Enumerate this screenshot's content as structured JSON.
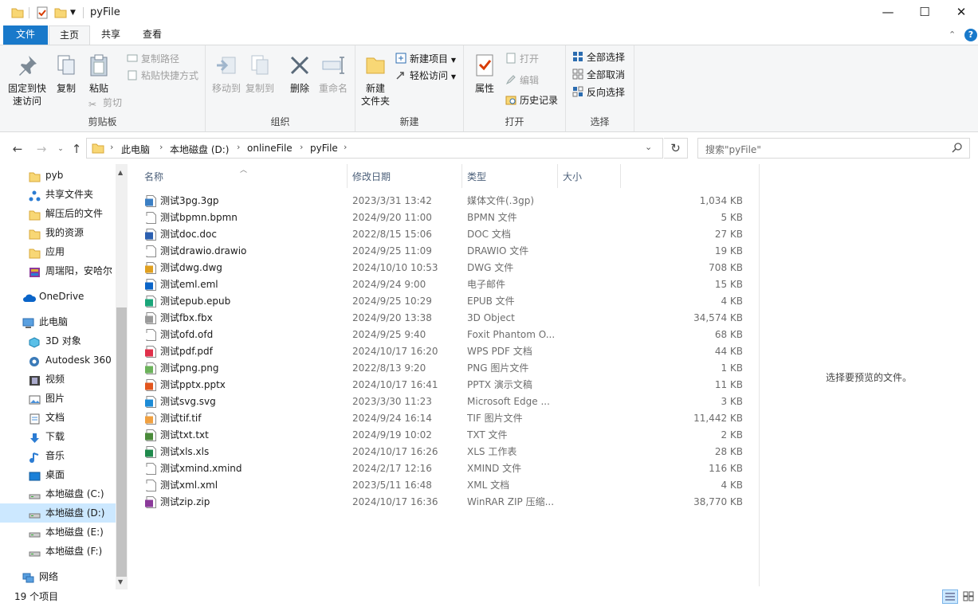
{
  "window": {
    "title": "pyFile",
    "minimize": "—",
    "maximize": "☐",
    "close": "✕"
  },
  "ribbon_tabs": [
    "文件",
    "主页",
    "共享",
    "查看"
  ],
  "ribbon": {
    "clipboard": {
      "pin": [
        "固定到快",
        "速访问"
      ],
      "copy": "复制",
      "paste": "粘贴",
      "copy_path": "复制路径",
      "paste_shortcut": "粘贴快捷方式",
      "cut": "剪切",
      "label": "剪贴板"
    },
    "organize": {
      "move_to": "移动到",
      "copy_to": "复制到",
      "delete": "删除",
      "rename": "重命名",
      "label": "组织"
    },
    "new": {
      "new_folder": [
        "新建",
        "文件夹"
      ],
      "new_item": "新建项目",
      "easy_access": "轻松访问",
      "label": "新建"
    },
    "open": {
      "properties": "属性",
      "open": "打开",
      "edit": "编辑",
      "history": "历史记录",
      "label": "打开"
    },
    "select": {
      "select_all": "全部选择",
      "select_none": "全部取消",
      "invert": "反向选择",
      "label": "选择"
    }
  },
  "address": {
    "crumbs": [
      "此电脑",
      "本地磁盘 (D:)",
      "onlineFile",
      "pyFile"
    ]
  },
  "search": {
    "placeholder": "搜索\"pyFile\""
  },
  "nav": [
    {
      "label": "pyb",
      "icon": "folder-icon"
    },
    {
      "label": "共享文件夹",
      "icon": "share-icon"
    },
    {
      "label": "解压后的文件",
      "icon": "folder-icon"
    },
    {
      "label": "我的资源",
      "icon": "folder-icon"
    },
    {
      "label": "应用",
      "icon": "folder-icon"
    },
    {
      "label": "周瑞阳，安哈尔",
      "icon": "archive-icon"
    },
    {
      "label": "OneDrive",
      "icon": "cloud-icon"
    },
    {
      "label": "此电脑",
      "icon": "pc-icon"
    },
    {
      "label": "3D 对象",
      "icon": "cube-icon"
    },
    {
      "label": "Autodesk 360",
      "icon": "autodesk-icon"
    },
    {
      "label": "视频",
      "icon": "video-icon"
    },
    {
      "label": "图片",
      "icon": "picture-icon"
    },
    {
      "label": "文档",
      "icon": "document-icon"
    },
    {
      "label": "下载",
      "icon": "download-icon"
    },
    {
      "label": "音乐",
      "icon": "music-icon"
    },
    {
      "label": "桌面",
      "icon": "desktop-icon"
    },
    {
      "label": "本地磁盘 (C:)",
      "icon": "drive-icon"
    },
    {
      "label": "本地磁盘 (D:)",
      "icon": "drive-icon",
      "selected": true
    },
    {
      "label": "本地磁盘 (E:)",
      "icon": "drive-icon"
    },
    {
      "label": "本地磁盘 (F:)",
      "icon": "drive-icon"
    },
    {
      "label": "网络",
      "icon": "network-icon"
    }
  ],
  "columns": {
    "name": "名称",
    "date": "修改日期",
    "type": "类型",
    "size": "大小"
  },
  "files": [
    {
      "name": "测试3pg.3gp",
      "date": "2023/3/31 13:42",
      "type": "媒体文件(.3gp)",
      "size": "1,034 KB",
      "color": "#3b7fc4"
    },
    {
      "name": "测试bpmn.bpmn",
      "date": "2024/9/20 11:00",
      "type": "BPMN 文件",
      "size": "5 KB",
      "color": "#ffffff"
    },
    {
      "name": "测试doc.doc",
      "date": "2022/8/15 15:06",
      "type": "DOC 文档",
      "size": "27 KB",
      "color": "#2b5fb0"
    },
    {
      "name": "测试drawio.drawio",
      "date": "2024/9/25 11:09",
      "type": "DRAWIO 文件",
      "size": "19 KB",
      "color": "#ffffff"
    },
    {
      "name": "测试dwg.dwg",
      "date": "2024/10/10 10:53",
      "type": "DWG 文件",
      "size": "708 KB",
      "color": "#e0a020"
    },
    {
      "name": "测试eml.eml",
      "date": "2024/9/24 9:00",
      "type": "电子邮件",
      "size": "15 KB",
      "color": "#0a64c8"
    },
    {
      "name": "测试epub.epub",
      "date": "2024/9/25 10:29",
      "type": "EPUB 文件",
      "size": "4 KB",
      "color": "#1aa67a"
    },
    {
      "name": "测试fbx.fbx",
      "date": "2024/9/20 13:38",
      "type": "3D Object",
      "size": "34,574 KB",
      "color": "#9a9a9a"
    },
    {
      "name": "测试ofd.ofd",
      "date": "2024/9/25 9:40",
      "type": "Foxit Phantom O...",
      "size": "68 KB",
      "color": "#ffffff"
    },
    {
      "name": "测试pdf.pdf",
      "date": "2024/10/17 16:20",
      "type": "WPS PDF 文档",
      "size": "44 KB",
      "color": "#e0304a"
    },
    {
      "name": "测试png.png",
      "date": "2022/8/13 9:20",
      "type": "PNG 图片文件",
      "size": "1 KB",
      "color": "#6bb25a"
    },
    {
      "name": "测试pptx.pptx",
      "date": "2024/10/17 16:41",
      "type": "PPTX 演示文稿",
      "size": "11 KB",
      "color": "#e2561e"
    },
    {
      "name": "测试svg.svg",
      "date": "2023/3/30 11:23",
      "type": "Microsoft Edge ...",
      "size": "3 KB",
      "color": "#1c8bd6"
    },
    {
      "name": "测试tif.tif",
      "date": "2024/9/24 16:14",
      "type": "TIF 图片文件",
      "size": "11,442 KB",
      "color": "#f0a040"
    },
    {
      "name": "测试txt.txt",
      "date": "2024/9/19 10:02",
      "type": "TXT 文件",
      "size": "2 KB",
      "color": "#4a8a3a"
    },
    {
      "name": "测试xls.xls",
      "date": "2024/10/17 16:26",
      "type": "XLS 工作表",
      "size": "28 KB",
      "color": "#1f8a4c"
    },
    {
      "name": "测试xmind.xmind",
      "date": "2024/2/17 12:16",
      "type": "XMIND 文件",
      "size": "116 KB",
      "color": "#ffffff"
    },
    {
      "name": "测试xml.xml",
      "date": "2023/5/11 16:48",
      "type": "XML 文档",
      "size": "4 KB",
      "color": "#ffffff"
    },
    {
      "name": "测试zip.zip",
      "date": "2024/10/17 16:36",
      "type": "WinRAR ZIP 压缩...",
      "size": "38,770 KB",
      "color": "#8b3a9a"
    }
  ],
  "preview": {
    "empty_text": "选择要预览的文件。"
  },
  "status": {
    "count": "19 个项目"
  }
}
